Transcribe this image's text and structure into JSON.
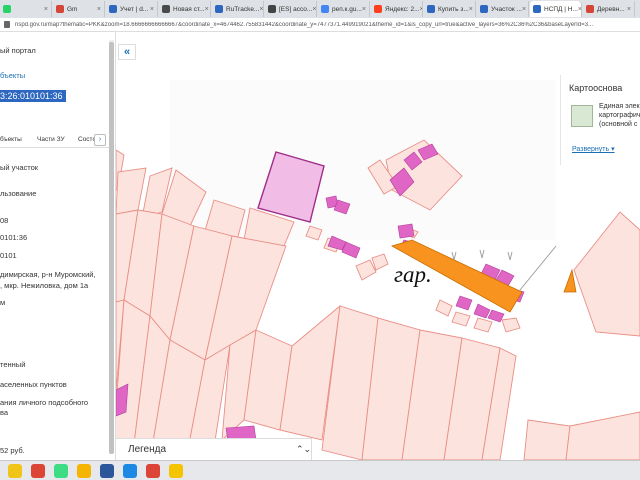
{
  "tabs": [
    {
      "label": "",
      "icon": "whatsapp-icon",
      "color": "#25d366"
    },
    {
      "label": "Gm",
      "icon": "gmail-icon",
      "color": "#d44638"
    },
    {
      "label": "Учет | d...",
      "icon": "page-icon",
      "color": "#2d67bf"
    },
    {
      "label": "Новая ст...",
      "icon": "page-icon",
      "color": "#4a4a4a"
    },
    {
      "label": "RuTracke...",
      "icon": "page-icon",
      "color": "#2d67bf"
    },
    {
      "label": "[ES] ассо...",
      "icon": "page-icon",
      "color": "#444"
    },
    {
      "label": "реп.к.gu...",
      "icon": "google-icon",
      "color": "#4285f4"
    },
    {
      "label": "Яндекс: 2...",
      "icon": "yandex-icon",
      "color": "#fc3f1d"
    },
    {
      "label": "Купить з...",
      "icon": "page-icon",
      "color": "#2d67bf"
    },
    {
      "label": "Участок ...",
      "icon": "page-icon",
      "color": "#2d67bf"
    },
    {
      "label": "НСПД | Н...",
      "icon": "page-icon",
      "color": "#2d67bf",
      "active": true
    },
    {
      "label": "Деревн...",
      "icon": "page-icon",
      "color": "#d44638"
    }
  ],
  "url": "nspd.gov.ru/map?thematic=PKK&zoom=18.66666666666667&coordinate_x=4674462.755831442&coordinate_y=7477371.449919021&theme_id=1&is_copy_url=true&active_layers=36%2C36%2C36&baseLayerId=3...",
  "sidebar": {
    "portal_label": "ый портал",
    "objects_link": "бъекты",
    "cadastral_number_selected": "3:26:010101:36",
    "tabs": [
      "бъекты",
      "Части ЗУ",
      "Состо..."
    ],
    "tab_arrow": "›",
    "lines": [
      "ый участок",
      "льзование",
      "08",
      "0101:36",
      "0101",
      "димирская, р-н Муромский,",
      ", мкр. Нежиловка, дом 1а",
      "м",
      "тенный",
      "аселенных пунктов",
      "ания личного подсобного",
      "ва",
      "52 руб."
    ]
  },
  "map": {
    "collapse_label": "«",
    "annotation_text": "гар.",
    "colors": {
      "parcel_fill": "#fde3de",
      "parcel_stroke": "#e88f86",
      "building_fill": "#e066c6",
      "building_stroke": "#b33d9b",
      "selected_fill": "#f1bde6",
      "selected_stroke": "#9e2e88",
      "garage_fill": "#f7931e",
      "garage_stroke": "#c76d00"
    }
  },
  "kartoosnova": {
    "title": "Картооснова",
    "desc_lines": [
      "Единая элек",
      "картографич",
      "(основной с"
    ],
    "expand_link": "Развернуть",
    "expand_chevron": "▾"
  },
  "legend": {
    "label": "Легенда",
    "arrow": "⌃⌄"
  },
  "taskbar": [
    {
      "icon": "start-icon",
      "color": "#f0c419"
    },
    {
      "icon": "chrome-icon",
      "color": "#db4437"
    },
    {
      "icon": "android-icon",
      "color": "#3ddc84"
    },
    {
      "icon": "folder-icon",
      "color": "#f4b400"
    },
    {
      "icon": "word-icon",
      "color": "#2b579a"
    },
    {
      "icon": "media-icon",
      "color": "#1e88e5"
    },
    {
      "icon": "chrome-icon-2",
      "color": "#db4437"
    },
    {
      "icon": "yandex-browser-icon",
      "color": "#f5c400"
    }
  ]
}
